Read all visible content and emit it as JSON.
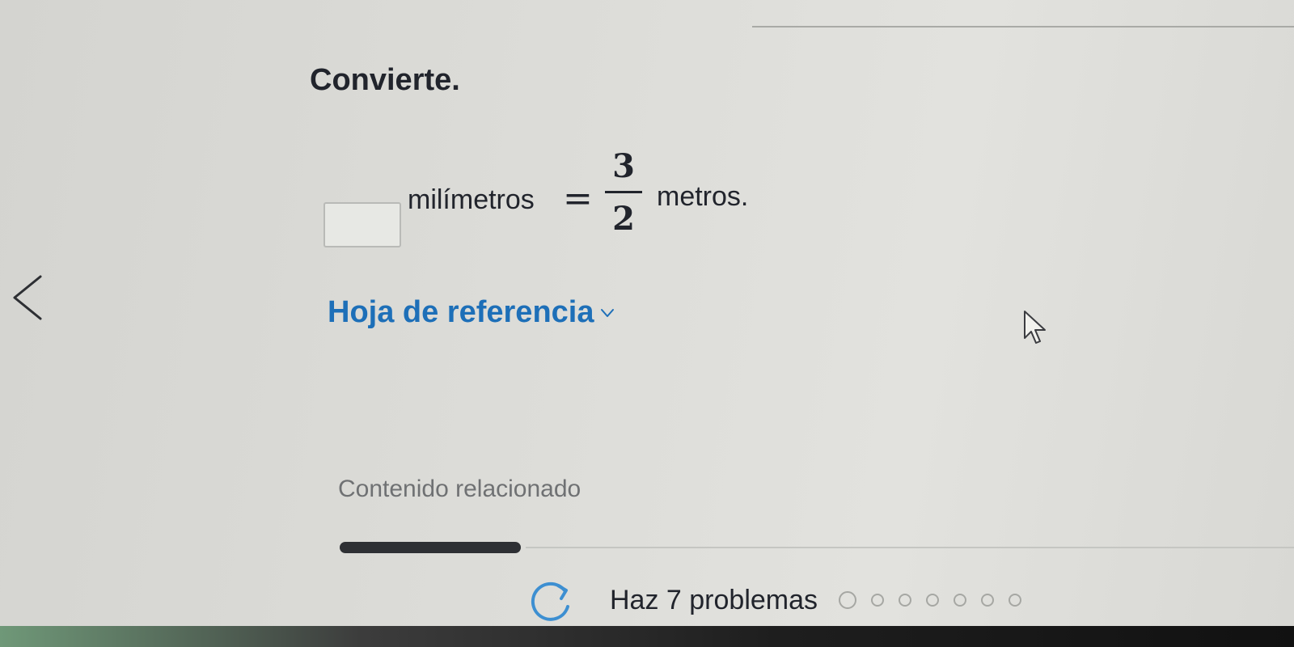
{
  "question": {
    "title": "Convierte.",
    "answer_value": "",
    "unit_left": "milímetros",
    "equals": "=",
    "fraction": {
      "numerator": "3",
      "denominator": "2"
    },
    "unit_right": "metros."
  },
  "reference": {
    "label": "Hoja de referencia"
  },
  "related": {
    "label": "Contenido relacionado"
  },
  "progress": {
    "label": "Haz 7 problemas",
    "total": 7,
    "completed": 0
  },
  "icons": {
    "back": "chevron-left-icon",
    "reference_toggle": "chevron-down-icon",
    "refresh": "refresh-icon",
    "pointer": "mouse-pointer-icon"
  },
  "colors": {
    "accent": "#1d6fb8",
    "text": "#21242c",
    "muted": "#6f7173"
  }
}
